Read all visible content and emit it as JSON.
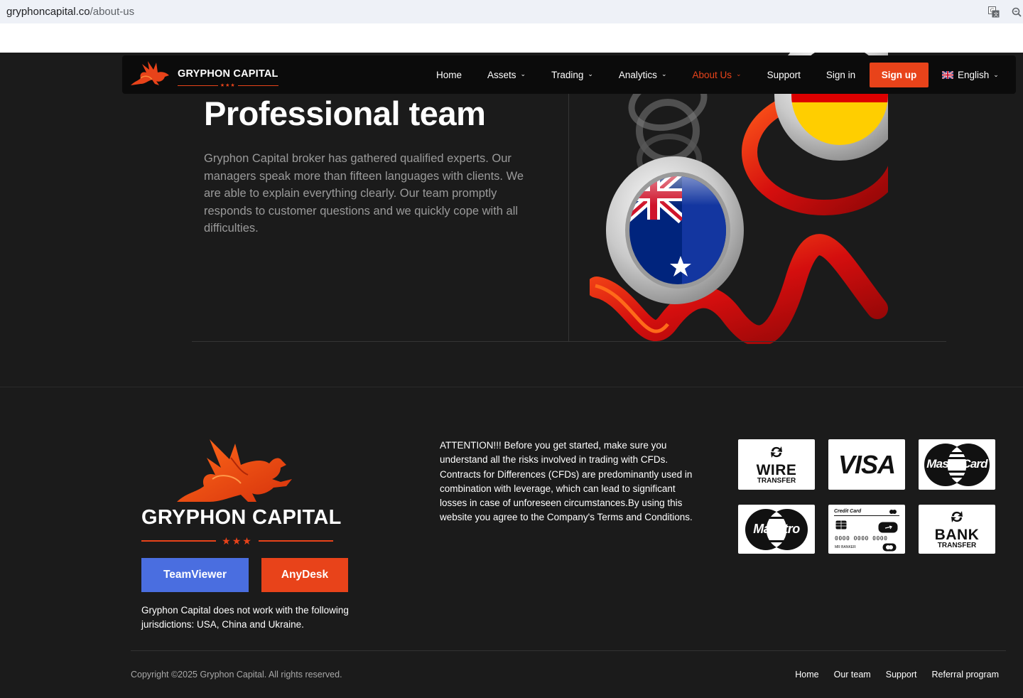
{
  "browser": {
    "url_host": "gryphoncapital.co",
    "url_path": "/about-us",
    "translate_icon": "translate-icon",
    "zoom_icon": "zoom-icon"
  },
  "nav": {
    "brand": "GRYPHON CAPITAL",
    "brand_stars": "★★★",
    "items": [
      {
        "label": "Home",
        "dropdown": false,
        "active": false
      },
      {
        "label": "Assets",
        "dropdown": true,
        "active": false
      },
      {
        "label": "Trading",
        "dropdown": true,
        "active": false
      },
      {
        "label": "Analytics",
        "dropdown": true,
        "active": false
      },
      {
        "label": "About Us",
        "dropdown": true,
        "active": true
      },
      {
        "label": "Support",
        "dropdown": false,
        "active": false
      },
      {
        "label": "Sign in",
        "dropdown": false,
        "active": false
      }
    ],
    "signup_label": "Sign up",
    "language": "English",
    "chevron": "⌄"
  },
  "hero": {
    "title": "Professional team",
    "text": "Gryphon Capital broker has gathered qualified experts. Our managers speak more than fifteen languages with clients. We are able to explain everything clearly. Our team promptly responds to customer questions and we quickly cope with all difficulties."
  },
  "footer": {
    "brand": "GRYPHON CAPITAL",
    "stars": "★★★",
    "teamviewer_label": "TeamViewer",
    "anydesk_label": "AnyDesk",
    "jurisdictions": "Gryphon Capital does not work with the following jurisdictions: USA, China and Ukraine.",
    "attention": "ATTENTION!!! Before you get started, make sure you understand all the risks involved in trading with CFDs. Contracts for Differences (CFDs) are predominantly used in combination with leverage, which can lead to significant losses in case of unforeseen circumstances.By using this website you agree to the Company's Terms and Conditions.",
    "payments": {
      "wire_line1": "WIRE",
      "wire_line2": "TRANSFER",
      "visa": "VISA",
      "mastercard": "MasterCard",
      "maestro": "Maestro",
      "card_title": "Credit Card",
      "card_number": "0000 0000 0000",
      "card_holder": "MR BANKER",
      "bank_line1": "BANK",
      "bank_line2": "TRANSFER"
    },
    "copyright": "Copyright ©2025 Gryphon Capital. All rights reserved.",
    "links": [
      "Home",
      "Our team",
      "Support",
      "Referral program"
    ]
  },
  "colors": {
    "accent": "#e8431a",
    "teamviewer": "#4a6ee0",
    "background": "#1b1b1b",
    "nav_bg": "#0b0b0b"
  }
}
